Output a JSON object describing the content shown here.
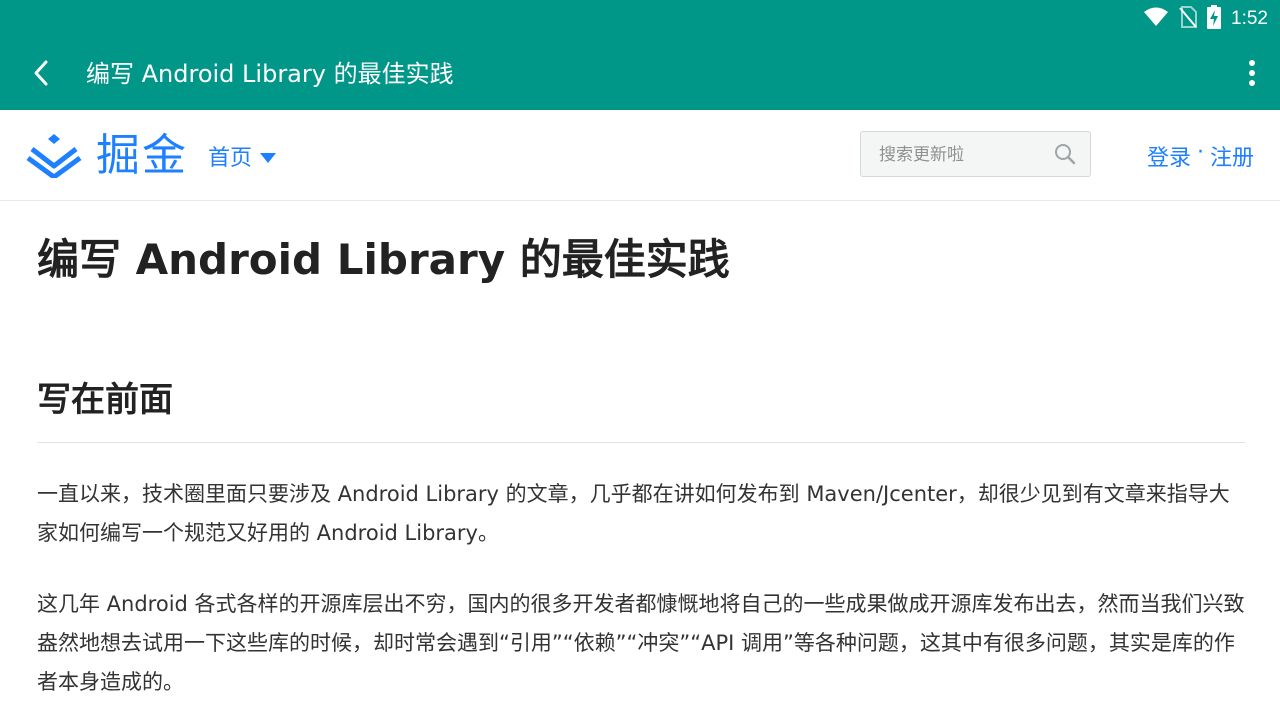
{
  "status_bar": {
    "time": "1:52",
    "icons": [
      "wifi-icon",
      "no-sim-icon",
      "battery-charging-icon"
    ]
  },
  "app_bar": {
    "title": "编写 Android Library 的最佳实践",
    "back_icon": "back-arrow-icon",
    "overflow_icon": "more-vertical-icon",
    "color": "#009688"
  },
  "site_header": {
    "logo_text": "掘金",
    "nav_home": "首页",
    "search_placeholder": "搜索更新啦",
    "login": "登录",
    "separator": "·",
    "register": "注册",
    "accent": "#1e80ff"
  },
  "article": {
    "title": "编写 Android Library 的最佳实践",
    "section_heading": "写在前面",
    "paragraphs": [
      "一直以来，技术圈里面只要涉及 Android Library 的文章，几乎都在讲如何发布到 Maven/Jcenter，却很少见到有文章来指导大家如何编写一个规范又好用的 Android Library。",
      "这几年 Android 各式各样的开源库层出不穷，国内的很多开发者都慷慨地将自己的一些成果做成开源库发布出去，然而当我们兴致盎然地想去试用一下这些库的时候，却时常会遇到“引用”“依赖”“冲突”“API 调用”等各种问题，这其中有很多问题，其实是库的作者本身造成的。"
    ]
  }
}
